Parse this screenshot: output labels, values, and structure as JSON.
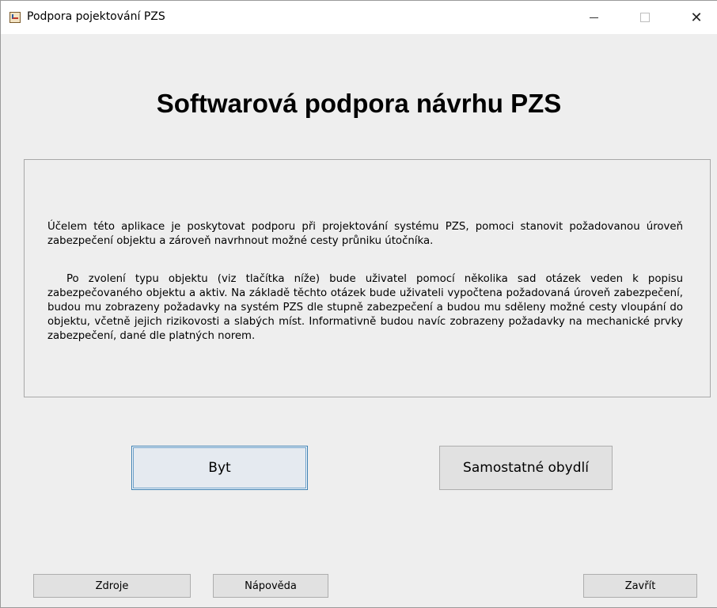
{
  "window": {
    "title": "Podpora pojektování PZS",
    "app_icon": "java-cup-icon",
    "controls": {
      "minimize": "minimize-icon",
      "maximize": "maximize-icon",
      "close_glyph": "✕"
    }
  },
  "main": {
    "heading": "Softwarová podpora návrhu PZS",
    "description": [
      "Účelem této aplikace je poskytovat podporu při projektování systému PZS, pomoci stanovit požadovanou úroveň zabezpečení objektu a zároveň navrhnout možné cesty průniku útočníka.",
      "Po zvolení typu objektu (viz tlačítka níže) bude uživatel pomocí několika sad otázek veden k popisu zabezpečovaného objektu a aktiv. Na základě těchto otázek bude uživateli vypočtena požadovaná úroveň zabezpečení, budou mu zobrazeny požadavky na systém PZS dle stupně zabezpečení a budou mu sděleny možné cesty vloupání do objektu, včetně jejich rizikovosti a slabých míst. Informativně budou navíc zobrazeny požadavky na mechanické prvky zabezpečení, dané dle platných norem."
    ],
    "object_buttons": {
      "byt": "Byt",
      "samostatne": "Samostatné obydlí"
    }
  },
  "footer": {
    "zdroje": "Zdroje",
    "napoveda": "Nápověda",
    "zavrit": "Zavřít"
  }
}
